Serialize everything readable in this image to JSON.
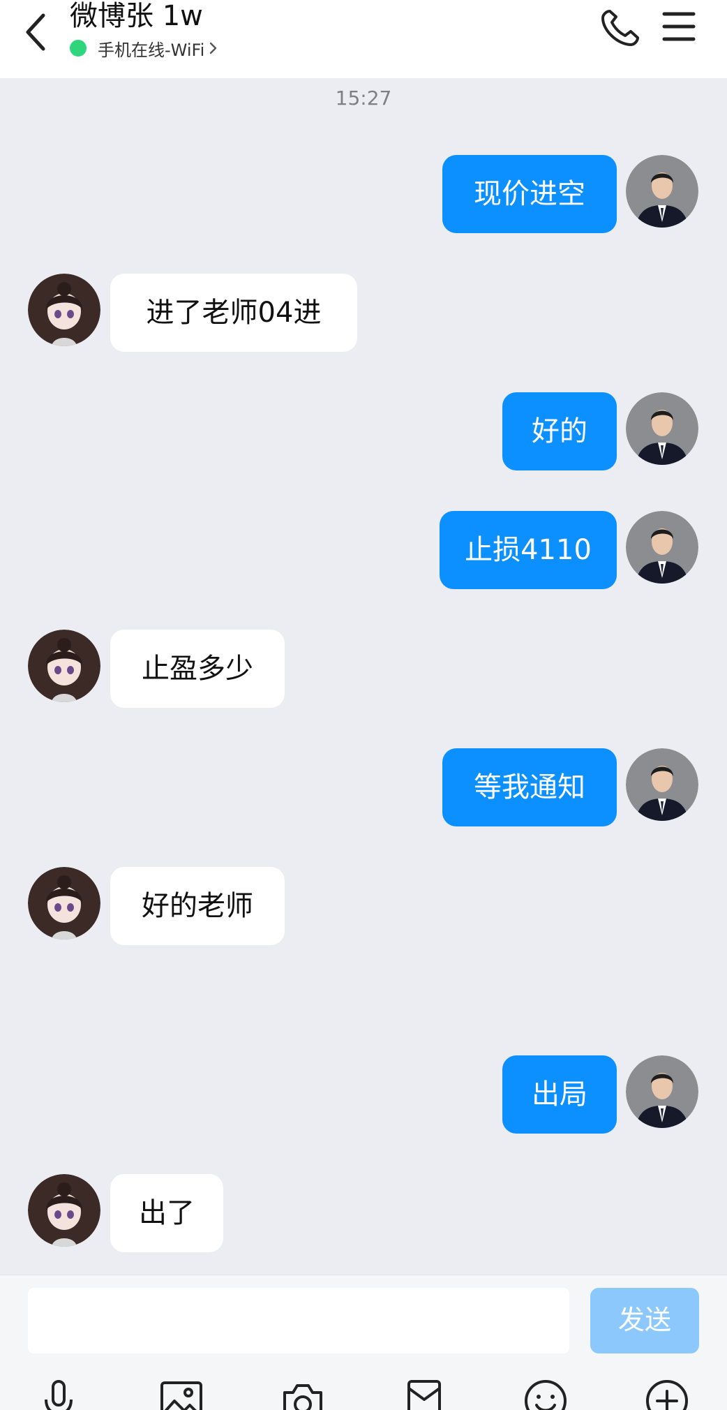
{
  "header": {
    "title": "微博张 1w",
    "status_text": "手机在线-WiFi",
    "status_color": "#2fd57a"
  },
  "timestamp": "15:27",
  "messages": [
    {
      "from": "me",
      "text": "现价进空"
    },
    {
      "from": "them",
      "text": "进了老师04进"
    },
    {
      "from": "me",
      "text": "好的"
    },
    {
      "from": "me",
      "text": "止损4110"
    },
    {
      "from": "them",
      "text": "止盈多少"
    },
    {
      "from": "me",
      "text": "等我通知"
    },
    {
      "from": "them",
      "text": "好的老师"
    },
    {
      "from": "me",
      "text": "出局"
    },
    {
      "from": "them",
      "text": "出了"
    }
  ],
  "input": {
    "placeholder": "",
    "send_label": "发送"
  },
  "toolbar": [
    "microphone-icon",
    "image-icon",
    "camera-icon",
    "red-packet-icon",
    "emoji-icon",
    "plus-icon"
  ],
  "colors": {
    "my_bubble": "#0c8fff",
    "their_bubble": "#ffffff",
    "send_button": "#8cc8fc",
    "background": "#ecedf2"
  }
}
